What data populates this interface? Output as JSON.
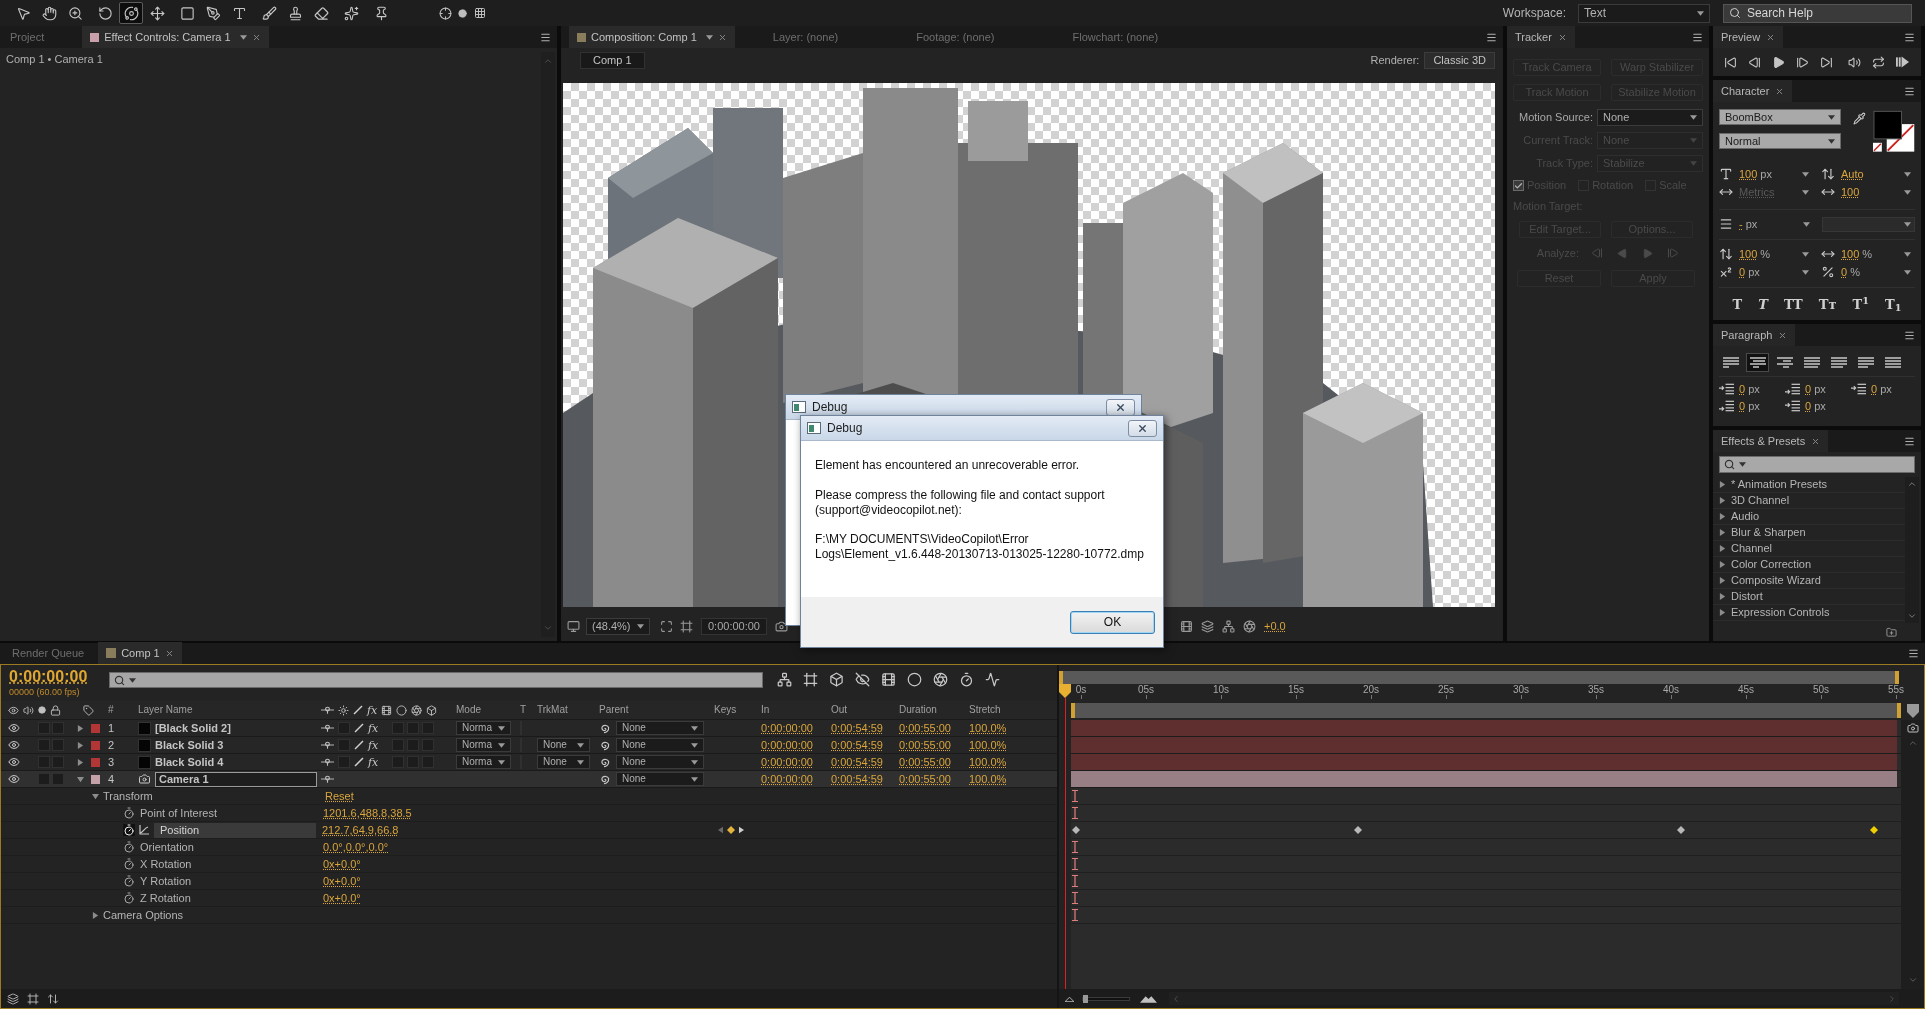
{
  "toolbar": {
    "tools": [
      {
        "selected": false
      },
      {
        "selected": false
      },
      {
        "selected": false
      },
      {
        "selected": false
      },
      {
        "selected": true
      },
      {
        "selected": false
      },
      {
        "selected": false
      },
      {
        "selected": false
      },
      {
        "selected": false
      },
      {
        "selected": false
      },
      {
        "selected": false
      },
      {
        "selected": false
      },
      {
        "selected": false
      },
      {
        "selected": false
      }
    ],
    "workspace": {
      "label": "Workspace:",
      "value": "Text"
    },
    "search_help": {
      "placeholder": "Search Help"
    }
  },
  "effect_controls_panel": {
    "tabs": [
      {
        "label": "Project",
        "selected": false
      },
      {
        "label": "Effect Controls: Camera 1",
        "selected": true
      }
    ],
    "breadcrumb": "Comp 1 • Camera 1"
  },
  "composition_panel": {
    "tabs": [
      {
        "label": "Composition: Comp 1",
        "selected": true
      },
      {
        "label": "Layer: (none)",
        "selected": false
      },
      {
        "label": "Footage: (none)",
        "selected": false
      },
      {
        "label": "Flowchart: (none)",
        "selected": false
      }
    ],
    "comp_button": "Comp 1",
    "renderer_label": "Renderer:",
    "renderer": "Classic 3D",
    "viewer_bar": {
      "zoom": "(48.4%)",
      "timecode": "0:00:00:00",
      "exposure": "+0.0"
    }
  },
  "tracker": {
    "title": "Tracker",
    "buttons": [
      {
        "label": "Track Camera",
        "disabled": true
      },
      {
        "label": "Warp Stabilizer",
        "disabled": true
      },
      {
        "label": "Track Motion",
        "disabled": true
      },
      {
        "label": "Stabilize Motion",
        "disabled": true
      }
    ],
    "fields": [
      {
        "label": "Motion Source:",
        "value": "None",
        "disabled": false
      },
      {
        "label": "Current Track:",
        "value": "None",
        "disabled": true
      },
      {
        "label": "Track Type:",
        "value": "Stabilize",
        "disabled": true
      }
    ],
    "options": [
      {
        "label": "Position",
        "checked": true,
        "disabled": true
      },
      {
        "label": "Rotation",
        "checked": false,
        "disabled": true
      },
      {
        "label": "Scale",
        "checked": false,
        "disabled": true
      }
    ],
    "motion_target": {
      "label": "Motion Target:",
      "disabled": true
    },
    "target_buttons": [
      {
        "label": "Edit Target...",
        "disabled": true
      },
      {
        "label": "Options...",
        "disabled": true
      }
    ],
    "analyze": {
      "label": "Analyze:",
      "disabled": true
    },
    "action_buttons": [
      {
        "label": "Reset",
        "disabled": true
      },
      {
        "label": "Apply",
        "disabled": true
      }
    ]
  },
  "preview": {
    "title": "Preview"
  },
  "character": {
    "title": "Character",
    "font": "BoomBox",
    "style": "Normal",
    "fields": [
      {
        "value": "100",
        "unit": "px",
        "disabled": false
      },
      {
        "value": "Auto",
        "disabled": false
      },
      {
        "value": "Metrics",
        "disabled": true
      },
      {
        "value": "100",
        "disabled": false
      },
      {
        "value": "-",
        "unit": "px",
        "disabled": false
      },
      {
        "value": "100",
        "unit": "%",
        "disabled": false
      },
      {
        "value": "100",
        "unit": "%",
        "disabled": false
      },
      {
        "value": "0",
        "unit": "px",
        "disabled": false
      },
      {
        "value": "0",
        "unit": "%",
        "disabled": false
      }
    ],
    "style_buttons": [
      {
        "label": "T",
        "kind": "bold"
      },
      {
        "label": "T",
        "kind": "italic"
      },
      {
        "label": "TT",
        "kind": "caps"
      },
      {
        "label": "Tᴛ",
        "kind": "small_caps"
      },
      {
        "label": "T$^{1}$",
        "kind": "super"
      },
      {
        "label": "T$_{1}$",
        "kind": "sub"
      }
    ]
  },
  "paragraph": {
    "title": "Paragraph",
    "alignment": [
      {
        "selected": false
      },
      {
        "selected": true
      },
      {
        "selected": false
      },
      {
        "selected": false
      },
      {
        "selected": false
      },
      {
        "selected": false
      },
      {
        "selected": false
      }
    ],
    "indents": [
      {
        "value": "0",
        "unit": "px"
      },
      {
        "value": "0",
        "unit": "px"
      },
      {
        "value": "0",
        "unit": "px"
      },
      {
        "value": "0",
        "unit": "px"
      },
      {
        "value": "0",
        "unit": "px"
      }
    ]
  },
  "effects_presets": {
    "title": "Effects & Presets",
    "items": [
      {
        "label": "* Animation Presets",
        "expanded": false
      },
      {
        "label": "3D Channel",
        "expanded": false
      },
      {
        "label": "Audio",
        "expanded": false
      },
      {
        "label": "Blur & Sharpen",
        "expanded": false
      },
      {
        "label": "Channel",
        "expanded": false
      },
      {
        "label": "Color Correction",
        "expanded": false
      },
      {
        "label": "Composite Wizard",
        "expanded": false
      },
      {
        "label": "Distort",
        "expanded": false
      },
      {
        "label": "Expression Controls",
        "expanded": false
      }
    ]
  },
  "timeline": {
    "tabs": [
      {
        "label": "Render Queue",
        "selected": false
      },
      {
        "label": "Comp 1",
        "selected": true
      }
    ],
    "timecode": "0:00:00:00",
    "frame_info": "00000 (60.00 fps)",
    "columns": [
      "#",
      "Layer Name",
      "Mode",
      "T",
      "TrkMat",
      "Parent",
      "Keys",
      "In",
      "Out",
      "Duration",
      "Stretch"
    ],
    "fx_header": "fx",
    "ruler": [
      "0s",
      "05s",
      "10s",
      "15s",
      "20s",
      "25s",
      "30s",
      "35s",
      "40s",
      "45s",
      "50s",
      "55s"
    ],
    "layers": [
      {
        "number": "1",
        "name": "[Black Solid 2]",
        "kind": "solid",
        "color": "#b23636",
        "expanded": false,
        "selected": false,
        "fx": "fx",
        "mode": "Norma",
        "parent": "None",
        "in": "0:00:00:00",
        "out": "0:00:54:59",
        "duration": "0:00:55:00",
        "stretch": "100.0%"
      },
      {
        "number": "2",
        "name": "Black Solid 3",
        "kind": "solid",
        "color": "#b23636",
        "expanded": false,
        "selected": false,
        "fx": "fx",
        "mode": "Norma",
        "trkmat": "None",
        "parent": "None",
        "in": "0:00:00:00",
        "out": "0:00:54:59",
        "duration": "0:00:55:00",
        "stretch": "100.0%"
      },
      {
        "number": "3",
        "name": "Black Solid 4",
        "kind": "solid",
        "color": "#b23636",
        "expanded": false,
        "selected": false,
        "fx": "fx",
        "mode": "Norma",
        "trkmat": "None",
        "parent": "None",
        "in": "0:00:00:00",
        "out": "0:00:54:59",
        "duration": "0:00:55:00",
        "stretch": "100.0%"
      },
      {
        "number": "4",
        "name": "Camera 1",
        "kind": "camera",
        "color": "#c4a0a9",
        "expanded": true,
        "selected": true,
        "parent": "None",
        "in": "0:00:00:00",
        "out": "0:00:54:59",
        "duration": "0:00:55:00",
        "stretch": "100.0%",
        "properties": [
          {
            "name": "Transform",
            "value": "Reset",
            "expanded": true,
            "children": [
              {
                "name": "Point of Interest",
                "value": "1201.6,488.8,38.5",
                "selected": false
              },
              {
                "name": "Position",
                "value": "212.7,64.9,66.8",
                "selected": true,
                "keyframes": [
                  {
                    "level": 0,
                    "selected": false
                  },
                  {
                    "level": 0.345,
                    "selected": false
                  },
                  {
                    "level": 0.741,
                    "selected": false
                  },
                  {
                    "level": 0.978,
                    "selected": true
                  }
                ]
              },
              {
                "name": "Orientation",
                "value": "0.0°,0.0°,0.0°",
                "selected": false
              },
              {
                "name": "X Rotation",
                "value": "0x+0.0°",
                "selected": false
              },
              {
                "name": "Y Rotation",
                "value": "0x+0.0°",
                "selected": false
              },
              {
                "name": "Z Rotation",
                "value": "0x+0.0°",
                "selected": false
              }
            ]
          },
          {
            "name": "Camera Options",
            "expanded": false
          }
        ]
      }
    ]
  },
  "dialogs": [
    {
      "title": "Debug"
    },
    {
      "title": "Debug",
      "message": "Element has encountered an unrecoverable error.",
      "body": "Please compress the following file and contact support\n(support@videocopilot.net):",
      "path": "F:\\MY DOCUMENTS\\VideoCopilot\\Error\nLogs\\Element_v1.6.448-20130713-013025-12280-10772.dmp",
      "button": "OK"
    }
  ]
}
